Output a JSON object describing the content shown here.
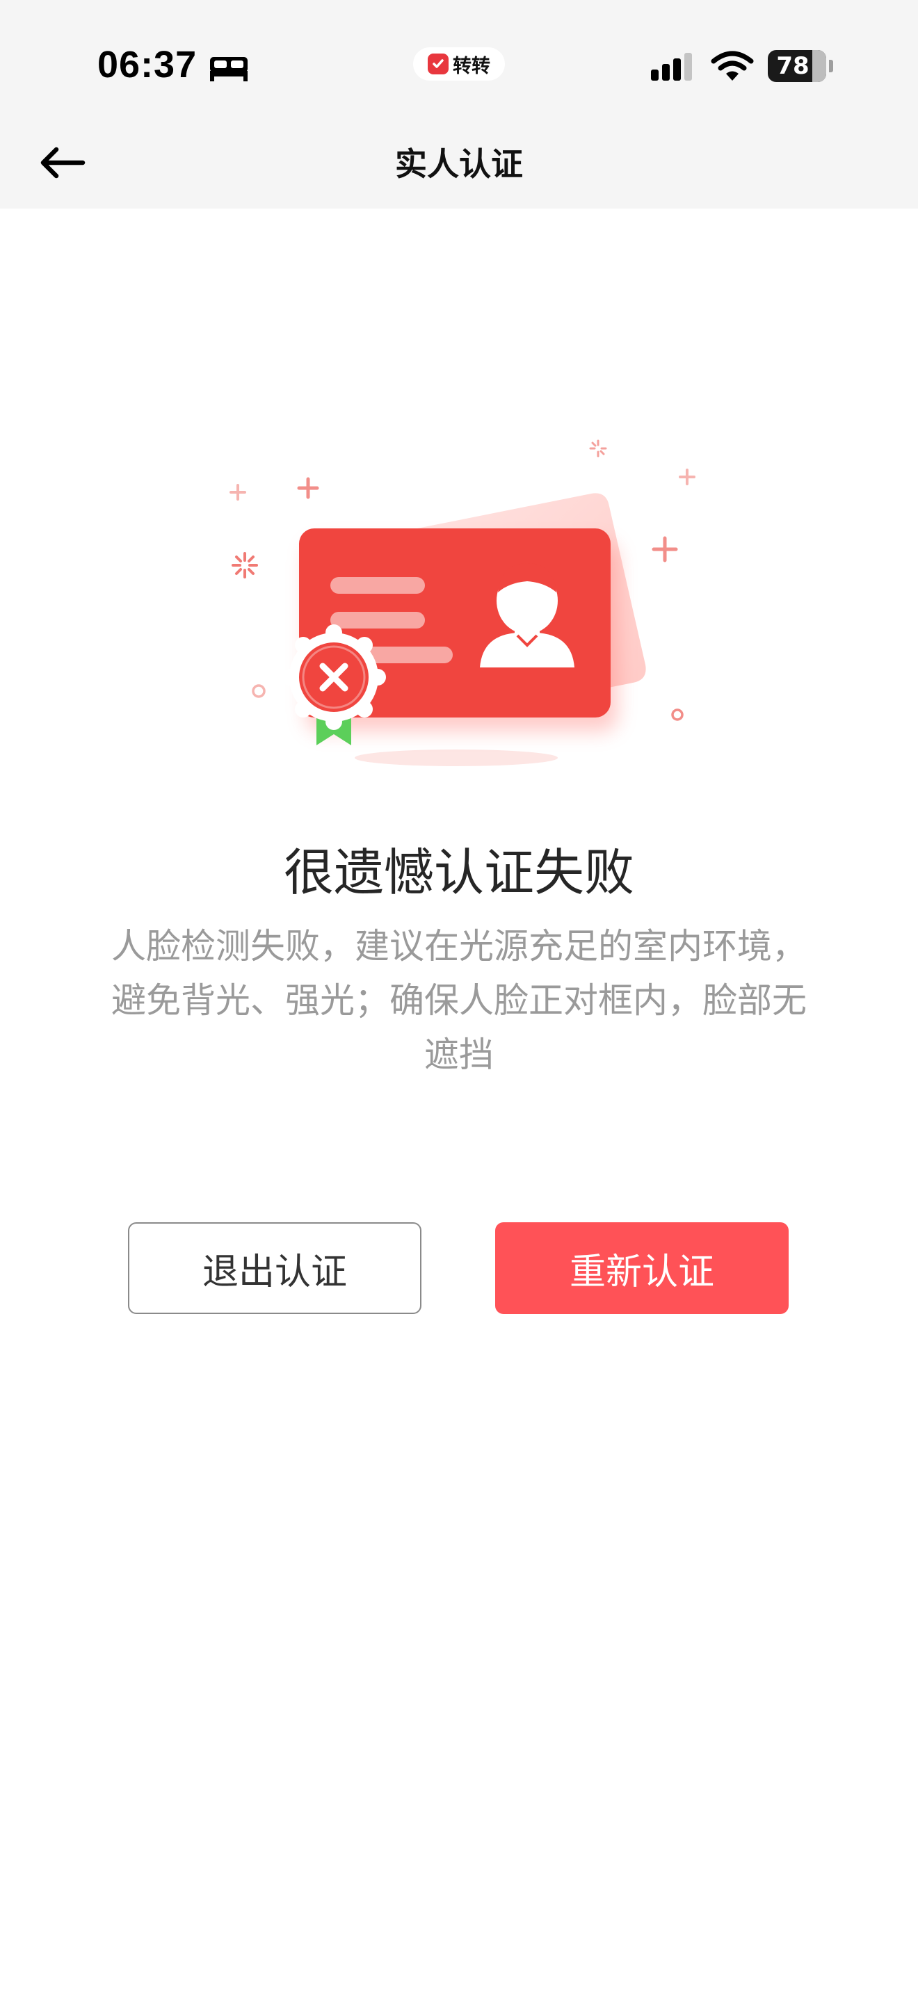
{
  "status_bar": {
    "time": "06:37",
    "app_name": "转转",
    "battery": "78",
    "icons": [
      "bed-icon",
      "signal-icon",
      "wifi-icon",
      "battery-icon"
    ]
  },
  "nav": {
    "title": "实人认证",
    "back_icon": "arrow-left-icon"
  },
  "result": {
    "title": "很遗憾认证失败",
    "description": "人脸检测失败，建议在光源充足的室内环境，避免背光、强光；确保人脸正对框内，脸部无遮挡"
  },
  "buttons": {
    "exit_label": "退出认证",
    "retry_label": "重新认证"
  },
  "colors": {
    "accent": "#ff5257",
    "card": "#f0453f",
    "ribbon": "#5ccf5a"
  }
}
